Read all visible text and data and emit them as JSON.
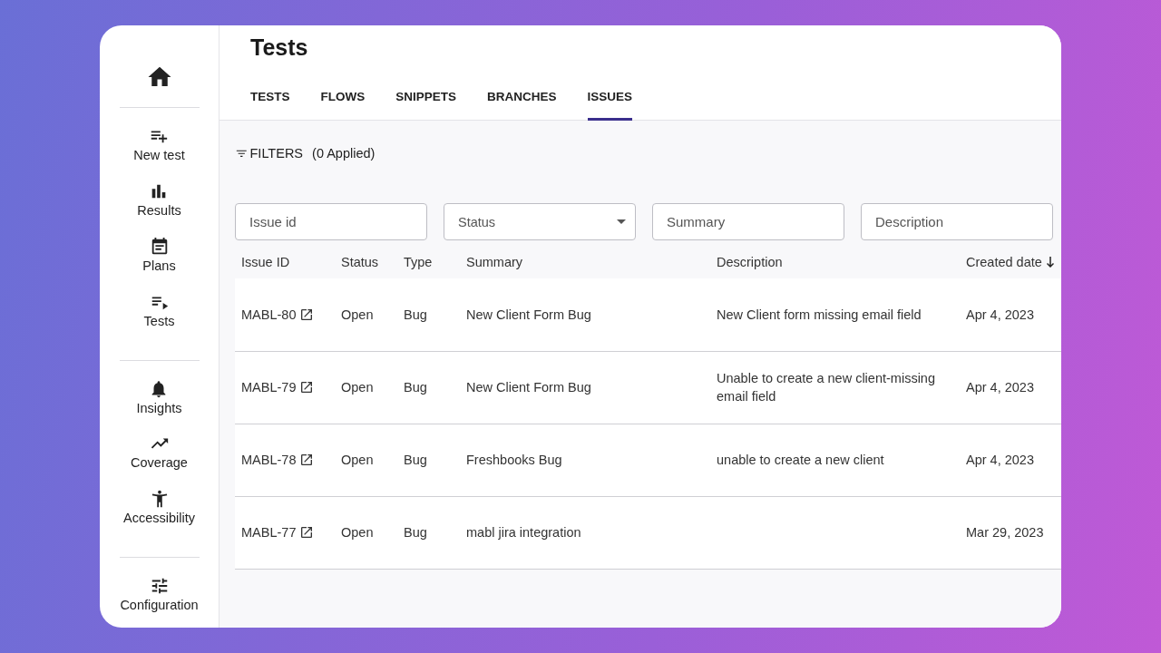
{
  "sidebar": {
    "items": [
      {
        "kind": "home"
      },
      {
        "kind": "divider"
      },
      {
        "kind": "new-test",
        "label": "New test"
      },
      {
        "kind": "results",
        "label": "Results"
      },
      {
        "kind": "plans",
        "label": "Plans"
      },
      {
        "kind": "tests",
        "label": "Tests"
      },
      {
        "kind": "divider"
      },
      {
        "kind": "insights",
        "label": "Insights"
      },
      {
        "kind": "coverage",
        "label": "Coverage"
      },
      {
        "kind": "accessibility",
        "label": "Accessibility"
      },
      {
        "kind": "divider"
      },
      {
        "kind": "configuration",
        "label": "Configuration"
      }
    ]
  },
  "page": {
    "title": "Tests"
  },
  "tabs": [
    {
      "label": "TESTS",
      "selected": false
    },
    {
      "label": "FLOWS",
      "selected": false
    },
    {
      "label": "SNIPPETS",
      "selected": false
    },
    {
      "label": "BRANCHES",
      "selected": false
    },
    {
      "label": "ISSUES",
      "selected": true
    }
  ],
  "filters": {
    "label": "FILTERS",
    "applied": "(0 Applied)"
  },
  "filter_fields": [
    {
      "kind": "text",
      "placeholder": "Issue id"
    },
    {
      "kind": "select",
      "placeholder": "Status"
    },
    {
      "kind": "text",
      "placeholder": "Summary"
    },
    {
      "kind": "text",
      "placeholder": "Description"
    }
  ],
  "table": {
    "columns": [
      {
        "label": "Issue ID",
        "sorted": false
      },
      {
        "label": "Status",
        "sorted": false
      },
      {
        "label": "Type",
        "sorted": false
      },
      {
        "label": "Summary",
        "sorted": false
      },
      {
        "label": "Description",
        "sorted": false
      },
      {
        "label": "Created date",
        "sorted": true
      }
    ],
    "rows": [
      {
        "id": "MABL-80",
        "status": "Open",
        "type": "Bug",
        "summary": "New Client Form Bug",
        "description": "New Client form missing email field",
        "created": "Apr 4, 2023"
      },
      {
        "id": "MABL-79",
        "status": "Open",
        "type": "Bug",
        "summary": "New Client Form Bug",
        "description": "Unable to create a new client-missing email field",
        "created": "Apr 4, 2023"
      },
      {
        "id": "MABL-78",
        "status": "Open",
        "type": "Bug",
        "summary": "Freshbooks Bug",
        "description": "unable to create a new client",
        "created": "Apr 4, 2023"
      },
      {
        "id": "MABL-77",
        "status": "Open",
        "type": "Bug",
        "summary": "mabl jira integration",
        "created": "Mar 29, 2023"
      }
    ]
  }
}
